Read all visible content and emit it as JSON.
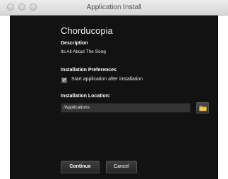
{
  "window": {
    "title": "Application Install"
  },
  "app": {
    "name": "Chorducopia"
  },
  "description": {
    "label": "Description",
    "value": "Its All About The Song"
  },
  "preferences": {
    "label": "Installation Preferences",
    "start_after_install": {
      "label": "Start application after installation",
      "checked": true
    }
  },
  "location": {
    "label": "Installation Location:",
    "path": "/Applications",
    "browse_icon": "folder-icon"
  },
  "buttons": {
    "continue_label": "Continue",
    "cancel_label": "Cancel"
  },
  "colors": {
    "content_background": "#121212",
    "titlebar_background": "#e0e0e0",
    "folder_icon": "#e8b330"
  }
}
